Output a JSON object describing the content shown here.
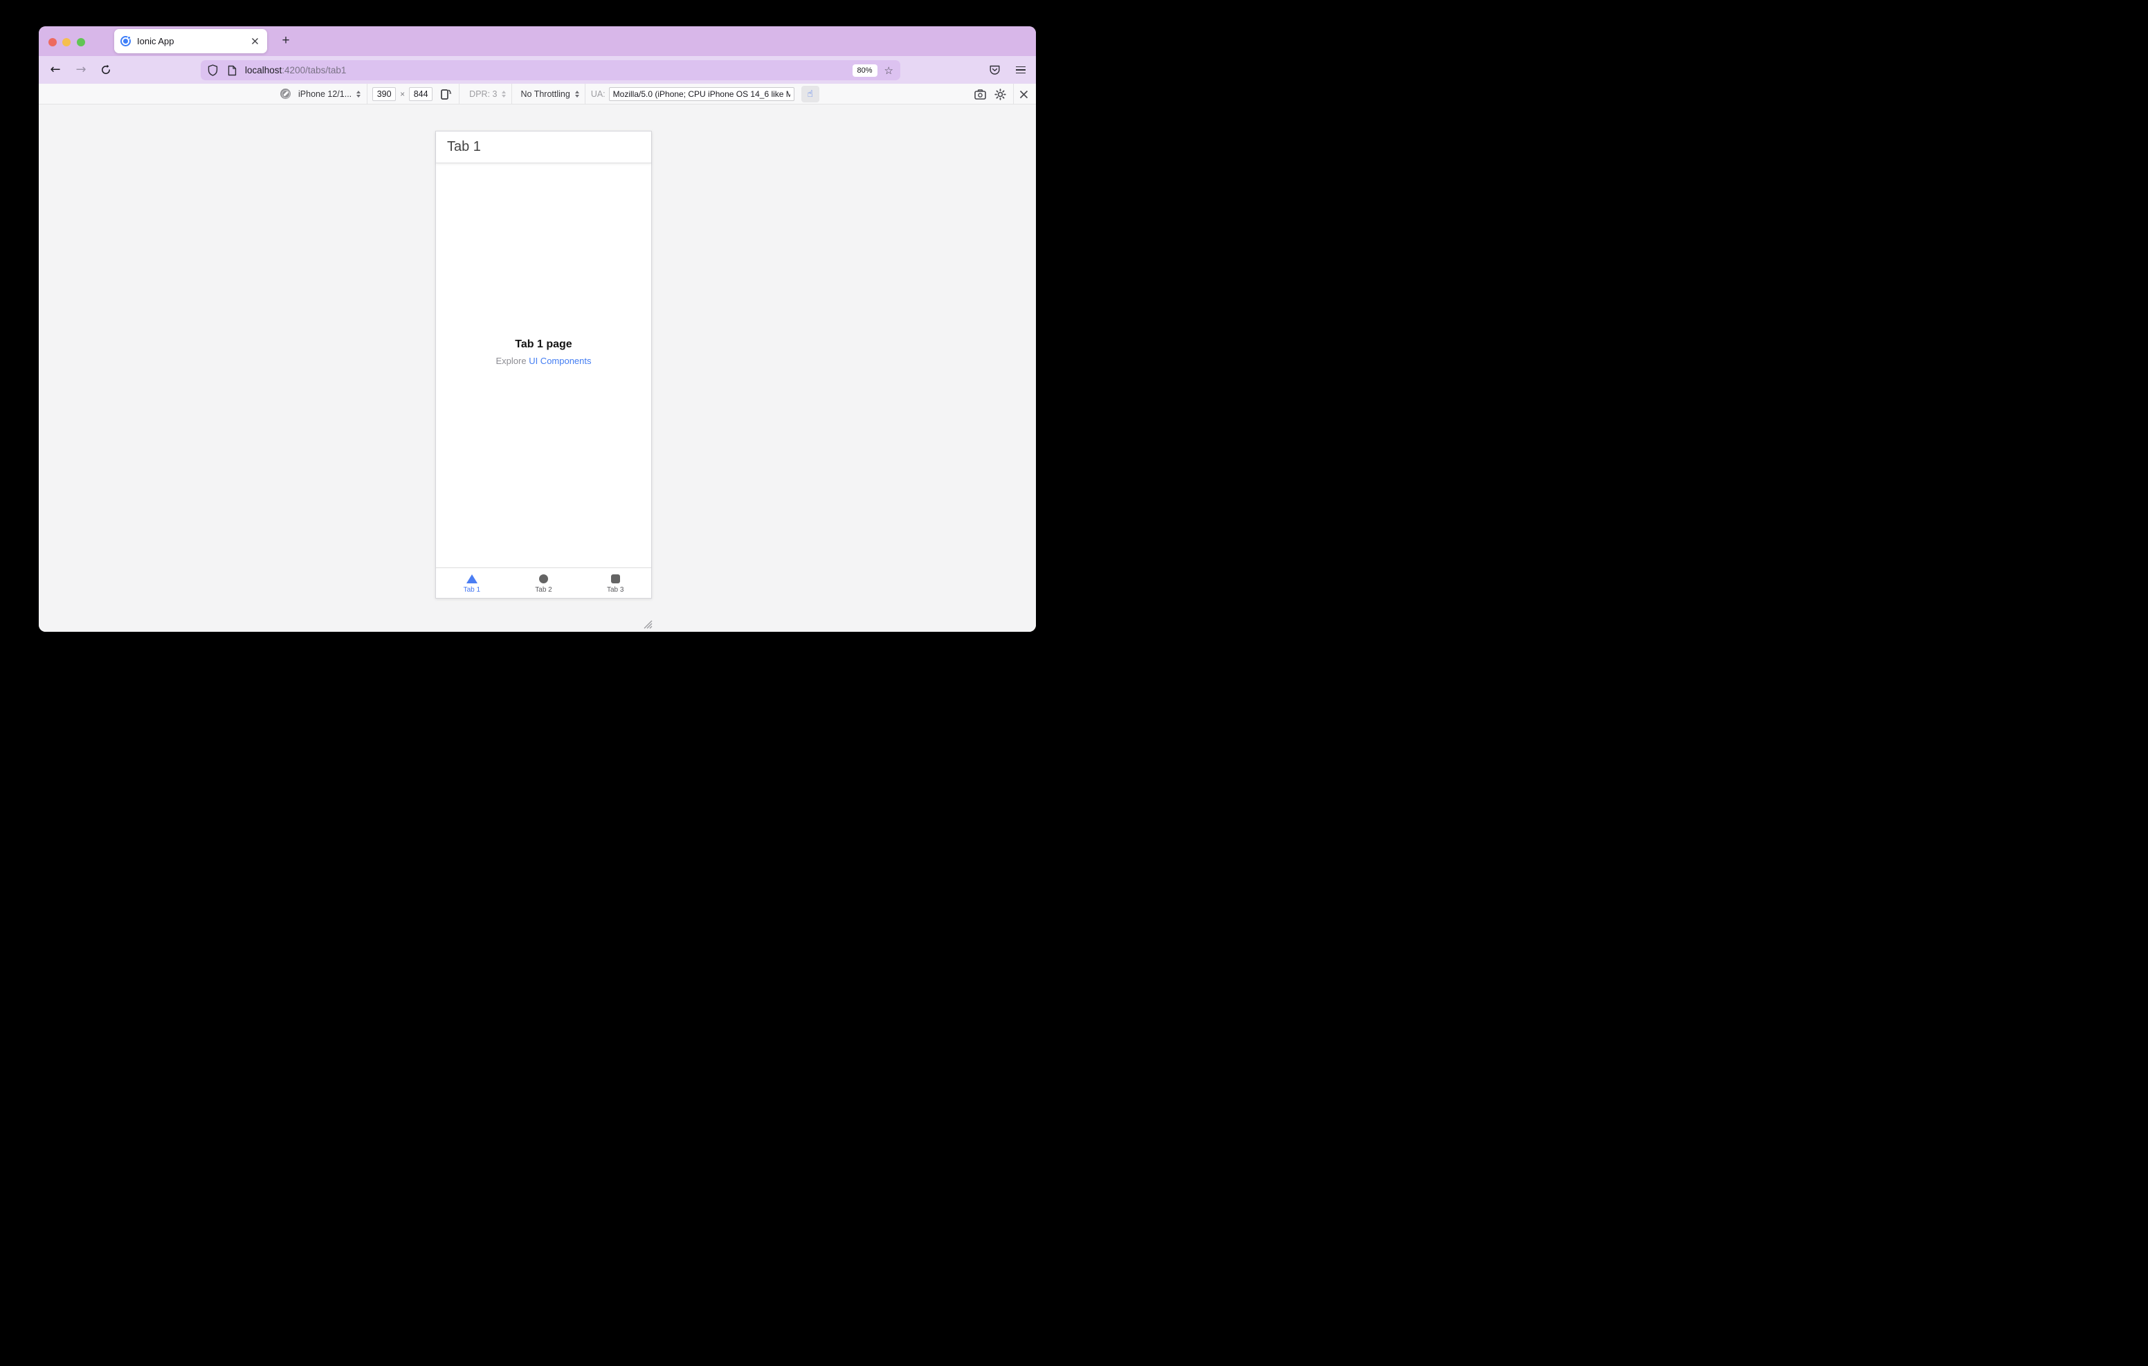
{
  "browser": {
    "window_title": "Ionic App",
    "traffic_lights": {
      "close": "#ed6a5f",
      "minimize": "#f5bf4f",
      "zoom": "#61c554"
    },
    "tab": {
      "title": "Ionic App",
      "favicon": "ionic-logo"
    },
    "new_tab_label": "+",
    "nav": {
      "url_host": "localhost",
      "url_rest": ":4200/tabs/tab1",
      "zoom_badge": "80%"
    }
  },
  "rdm_toolbar": {
    "device_label": "iPhone 12/1...",
    "width_value": "390",
    "times": "×",
    "height_value": "844",
    "dpr_label": "DPR: 3",
    "throttling_label": "No Throttling",
    "ua_label": "UA:",
    "ua_value": "Mozilla/5.0 (iPhone; CPU iPhone OS 14_6 like M"
  },
  "app": {
    "header_title": "Tab 1",
    "page_title": "Tab 1 page",
    "subtitle_prefix": "Explore ",
    "subtitle_link": "UI Components",
    "tabs": [
      {
        "label": "Tab 1",
        "shape": "triangle",
        "active": true
      },
      {
        "label": "Tab 2",
        "shape": "circle",
        "active": false
      },
      {
        "label": "Tab 3",
        "shape": "square",
        "active": false
      }
    ]
  },
  "icons": {
    "back": "←",
    "forward": "→",
    "reload": "reload-arc",
    "shield": "tracking-protection-shield",
    "page": "page-proxy-document",
    "star": "☆",
    "pocket": "pocket-save",
    "menu": "hamburger",
    "compass": "safari-device-browser",
    "rotate": "rotate-viewport-phone",
    "touch": "☝",
    "camera": "screenshot-camera",
    "settings": "gear",
    "close": "✕",
    "resize": "diagonal-grip"
  },
  "colors": {
    "titlebar": "#d8b7e9",
    "navbar": "#e7d7f4",
    "url_field": "#dcc2f0",
    "toolbar_bg": "#f8f8f9",
    "content_bg": "#f4f4f5",
    "accent_blue": "#4a7df3",
    "inactive_gray": "#646464"
  }
}
